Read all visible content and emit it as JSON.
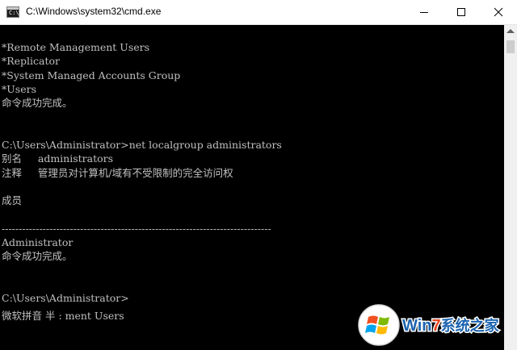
{
  "window": {
    "title": "C:\\Windows\\system32\\cmd.exe",
    "app_icon": "console-icon",
    "controls": [
      "minimize-icon",
      "maximize-icon",
      "close-icon"
    ]
  },
  "console": {
    "lines": [
      "*Remote Management Users",
      "*Replicator",
      "*System Managed Accounts Group",
      "*Users",
      "命令成功完成。",
      "",
      "",
      "C:\\Users\\Administrator>net localgroup administrators",
      "别名     administrators",
      "注释     管理员对计算机/域有不受限制的完全访问权",
      "",
      "成员",
      "",
      "-------------------------------------------------------------------------------",
      "Administrator",
      "命令成功完成。",
      "",
      "",
      "C:\\Users\\Administrator>"
    ],
    "ime_status": "微软拼音 半 : ment Users",
    "text_color": "#c0c0c0",
    "background_color": "#000000"
  },
  "watermark": {
    "logo_icon": "windows-logo-icon",
    "text_prefix": "Win",
    "text_digit": "7",
    "text_suffix": "系统之家",
    "colors": {
      "primary": "#1a63b0",
      "accent": "#e8441e"
    }
  }
}
